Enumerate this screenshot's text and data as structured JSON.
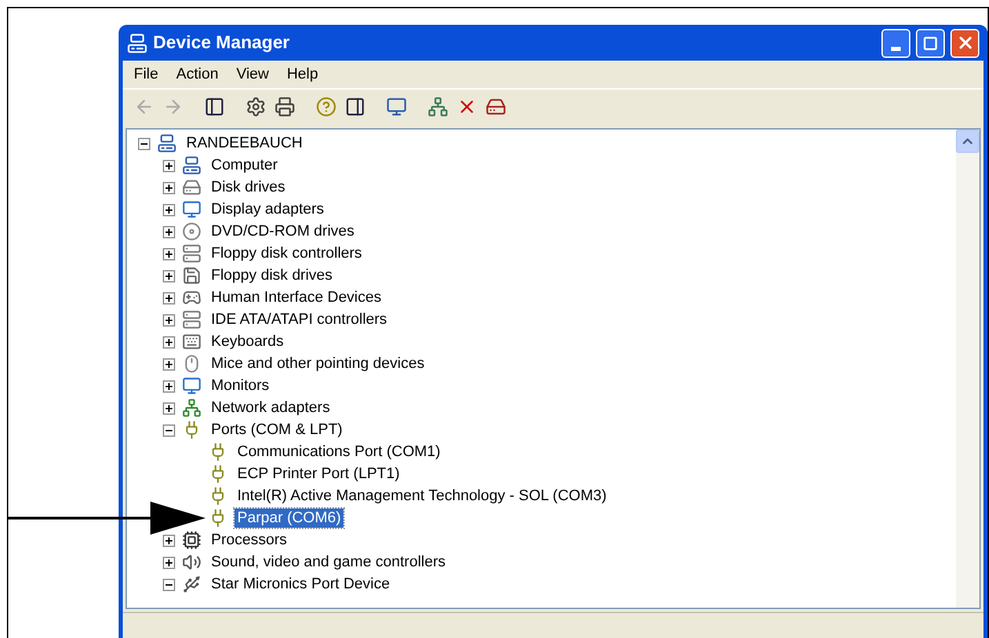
{
  "window": {
    "title": "Device Manager"
  },
  "menu": [
    "File",
    "Action",
    "View",
    "Help"
  ],
  "tree": {
    "label": "RANDEEBAUCH",
    "kind": "computer",
    "expanded": true,
    "children": [
      {
        "label": "Computer",
        "kind": "computer",
        "expanded": false,
        "selected": false
      },
      {
        "label": "Disk drives",
        "kind": "disk",
        "expanded": false,
        "selected": false
      },
      {
        "label": "Display adapters",
        "kind": "display",
        "expanded": false,
        "selected": false
      },
      {
        "label": "DVD/CD-ROM drives",
        "kind": "dvd",
        "expanded": false,
        "selected": false
      },
      {
        "label": "Floppy disk controllers",
        "kind": "controller",
        "expanded": false,
        "selected": false
      },
      {
        "label": "Floppy disk drives",
        "kind": "floppy",
        "expanded": false,
        "selected": false
      },
      {
        "label": "Human Interface Devices",
        "kind": "hid",
        "expanded": false,
        "selected": false
      },
      {
        "label": "IDE ATA/ATAPI controllers",
        "kind": "controller",
        "expanded": false,
        "selected": false
      },
      {
        "label": "Keyboards",
        "kind": "keyboard",
        "expanded": false,
        "selected": false
      },
      {
        "label": "Mice and other pointing devices",
        "kind": "mouse",
        "expanded": false,
        "selected": false
      },
      {
        "label": "Monitors",
        "kind": "display",
        "expanded": false,
        "selected": false
      },
      {
        "label": "Network adapters",
        "kind": "network",
        "expanded": false,
        "selected": false
      },
      {
        "label": "Ports (COM & LPT)",
        "kind": "port",
        "expanded": true,
        "selected": false,
        "children": [
          {
            "label": "Communications Port (COM1)",
            "kind": "port",
            "selected": false
          },
          {
            "label": "ECP Printer Port (LPT1)",
            "kind": "port",
            "selected": false
          },
          {
            "label": "Intel(R) Active Management Technology - SOL (COM3)",
            "kind": "port",
            "selected": false
          },
          {
            "label": "Parpar (COM6)",
            "kind": "port",
            "selected": true
          }
        ]
      },
      {
        "label": "Processors",
        "kind": "cpu",
        "expanded": false,
        "selected": false
      },
      {
        "label": "Sound, video and game controllers",
        "kind": "sound",
        "expanded": false,
        "selected": false
      },
      {
        "label": "Star Micronics Port Device",
        "kind": "star",
        "expanded": true,
        "selected": false
      }
    ]
  }
}
